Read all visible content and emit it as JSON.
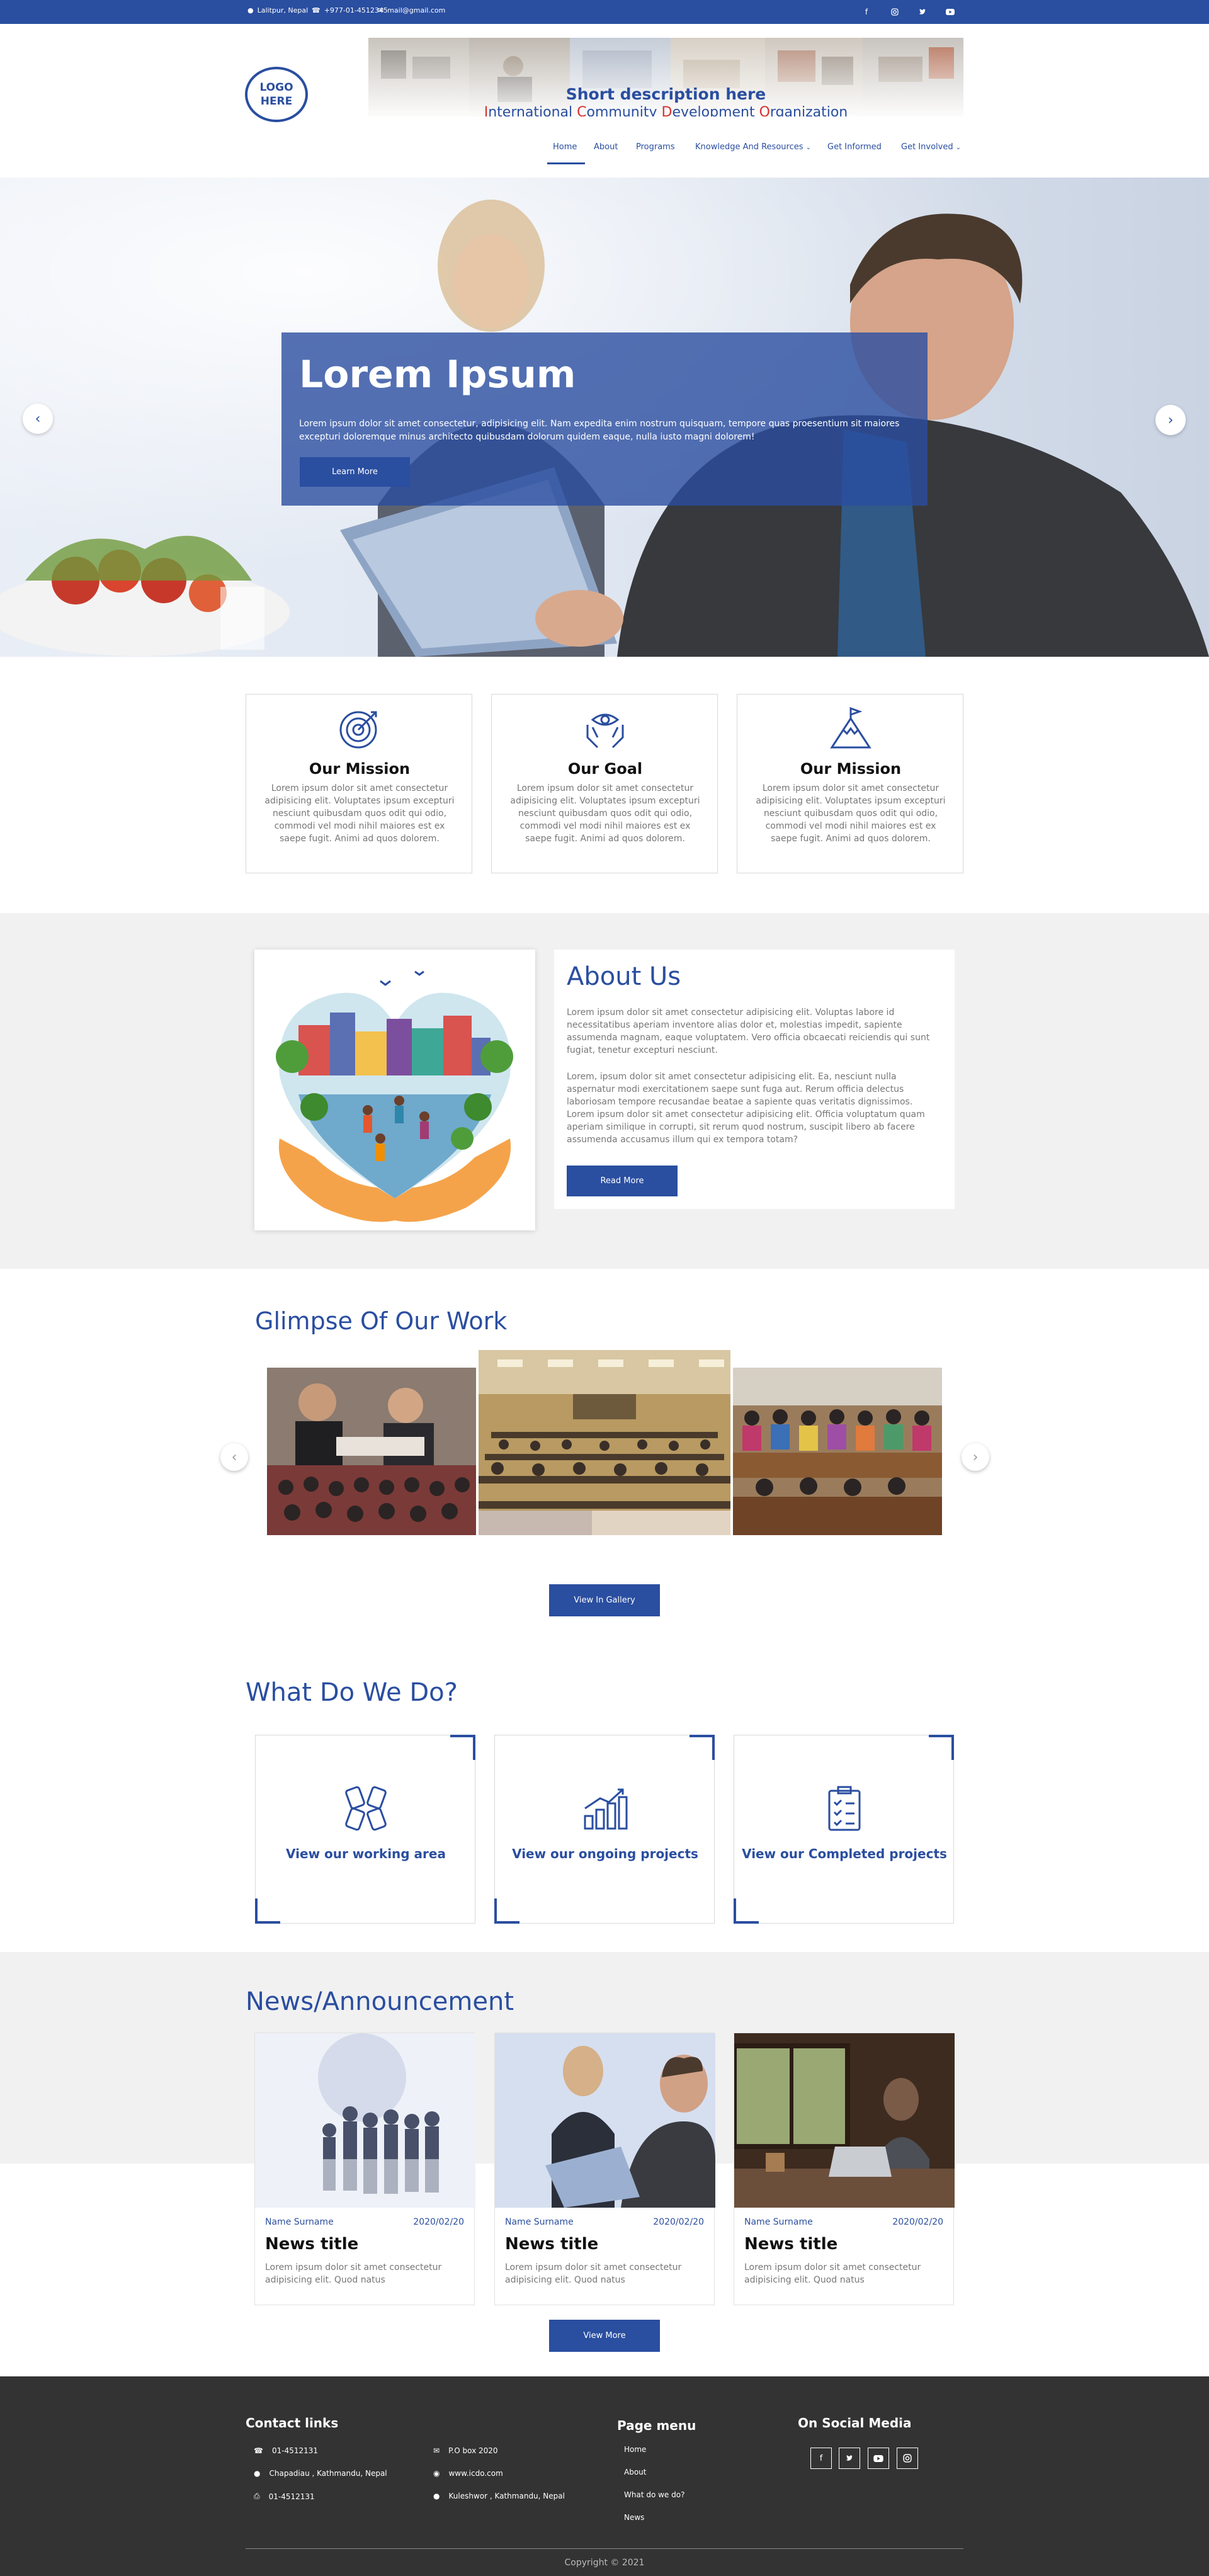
{
  "topbar": {
    "location": "Lalitpur, Nepal",
    "phone": "+977-01-4512345",
    "email": "mail@gmail.com",
    "social_icons": [
      "facebook-icon",
      "instagram-icon",
      "twitter-icon",
      "youtube-icon"
    ]
  },
  "header": {
    "logo_line1": "LOGO",
    "logo_line2": "HERE",
    "short_description": "Short description here",
    "org_name": [
      {
        "initial": "I",
        "rest": "nternational "
      },
      {
        "initial": "C",
        "rest": "ommunity "
      },
      {
        "initial": "D",
        "rest": "evelopment "
      },
      {
        "initial": "O",
        "rest": "rganization"
      }
    ]
  },
  "nav": {
    "items": [
      {
        "label": "Home",
        "active": true
      },
      {
        "label": "About"
      },
      {
        "label": "Programs"
      },
      {
        "label": "Knowledge And Resources",
        "dropdown": true
      },
      {
        "label": "Get Informed"
      },
      {
        "label": "Get Involved",
        "dropdown": true
      }
    ]
  },
  "hero": {
    "title": "Lorem Ipsum",
    "text": "Lorem ipsum dolor sit amet consectetur, adipisicing elit. Nam expedita enim nostrum quisquam, tempore quas proesentium sit maiores excepturi doloremque minus architecto quibusdam dolorum quidem eaque, nulla iusto magni dolorem!",
    "button": "Learn More"
  },
  "cards": [
    {
      "icon": "target-icon",
      "title": "Our Mission",
      "text": "Lorem ipsum dolor sit amet consectetur adipisicing elit. Voluptates ipsum excepturi nesciunt quibusdam quos odit qui odio, commodi vel modi nihil maiores est ex saepe fugit. Animi ad quos dolorem."
    },
    {
      "icon": "hands-eye-icon",
      "title": "Our Goal",
      "text": "Lorem ipsum dolor sit amet consectetur adipisicing elit. Voluptates ipsum excepturi nesciunt quibusdam quos odit qui odio, commodi vel modi nihil maiores est ex saepe fugit. Animi ad quos dolorem."
    },
    {
      "icon": "mountain-flag-icon",
      "title": "Our Mission",
      "text": "Lorem ipsum dolor sit amet consectetur adipisicing elit. Voluptates ipsum excepturi nesciunt quibusdam quos odit qui odio, commodi vel modi nihil maiores est ex saepe fugit. Animi ad quos dolorem."
    }
  ],
  "about": {
    "title": "About Us",
    "p1": "Lorem ipsum dolor sit amet consectetur adipisicing elit. Voluptas labore id necessitatibus aperiam inventore alias dolor et, molestias impedit, sapiente assumenda magnam, eaque voluptatem. Vero officia obcaecati reiciendis qui sunt fugiat, tenetur excepturi nesciunt.",
    "p2": "Lorem, ipsum dolor sit amet consectetur adipisicing elit. Ea, nesciunt nulla aspernatur modi exercitationem saepe sunt fuga aut. Rerum officia delectus laboriosam tempore recusandae beatae a sapiente quas veritatis dignissimos. Lorem ipsum dolor sit amet consectetur adipisicing elit. Officia voluptatum quam aperiam similique in corrupti, sit rerum quod nostrum, suscipit libero ab facere assumenda accusamus illum qui ex tempora totam?",
    "button": "Read More"
  },
  "glimpse": {
    "title": "Glimpse Of Our Work",
    "button": "View In Gallery"
  },
  "what_we_do": {
    "title": "What Do We Do?",
    "items": [
      {
        "icon": "handshake-icon",
        "label": "View our working area"
      },
      {
        "icon": "bar-growth-icon",
        "label": "View our ongoing projects"
      },
      {
        "icon": "clipboard-check-icon",
        "label": "View our Completed projects"
      }
    ]
  },
  "news": {
    "title": "News/Announcement",
    "items": [
      {
        "author": "Name Surname",
        "date": "2020/02/20",
        "title": "News title",
        "text": "Lorem ipsum dolor sit amet consectetur adipisicing elit. Quod natus"
      },
      {
        "author": "Name Surname",
        "date": "2020/02/20",
        "title": "News title",
        "text": "Lorem ipsum dolor sit amet consectetur adipisicing elit. Quod natus"
      },
      {
        "author": "Name Surname",
        "date": "2020/02/20",
        "title": "News title",
        "text": "Lorem ipsum dolor sit amet consectetur adipisicing elit. Quod natus"
      }
    ],
    "button": "View More"
  },
  "footer": {
    "contact_title": "Contact links",
    "contacts_left": [
      {
        "icon": "phone-icon",
        "text": "01-4512131"
      },
      {
        "icon": "location-icon",
        "text": "Chapadiau , Kathmandu, Nepal"
      },
      {
        "icon": "fax-icon",
        "text": "01-4512131"
      }
    ],
    "contacts_right": [
      {
        "icon": "mailbox-icon",
        "text": "P.O box 2020"
      },
      {
        "icon": "globe-icon",
        "text": "www.icdo.com"
      },
      {
        "icon": "location-icon",
        "text": "Kuleshwor , Kathmandu, Nepal"
      }
    ],
    "menu_title": "Page menu",
    "menu": [
      "Home",
      "About",
      "What do we do?",
      "News"
    ],
    "social_title": "On Social Media",
    "social_icons": [
      "facebook-icon",
      "twitter-icon",
      "youtube-icon",
      "instagram-icon"
    ],
    "copyright": "Copyright © 2021"
  },
  "colors": {
    "brand": "#2a4ea0",
    "accent_red": "#d6322f",
    "footer_bg": "#333333"
  }
}
